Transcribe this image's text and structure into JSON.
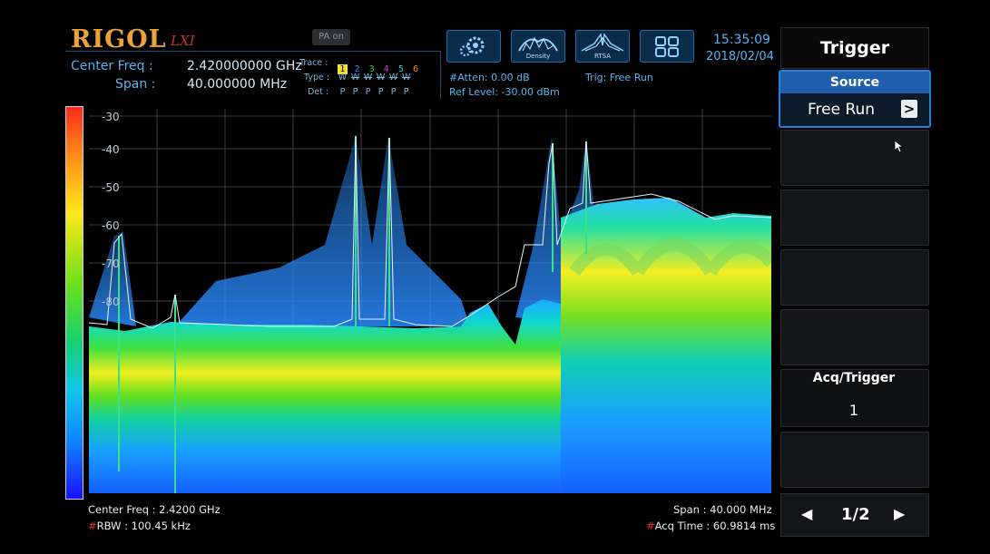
{
  "header": {
    "brand": "RIGOL",
    "brand_sub": "LXI",
    "pa_label": "PA on",
    "center_freq_label": "Center Freq :",
    "center_freq_value": "2.420000000 GHz",
    "span_label": "Span :",
    "span_value": "40.000000 MHz",
    "trace_label": "Trace :",
    "trace_numbers": [
      "1",
      "2",
      "3",
      "4",
      "5",
      "6"
    ],
    "trace_colors": [
      "#f5e32a",
      "#1e90ff",
      "#2ecc40",
      "#e040e0",
      "#21d4e0",
      "#ff8a1a"
    ],
    "type_label": "Type :",
    "type_values": [
      "W",
      "W",
      "W",
      "W",
      "W",
      "W"
    ],
    "det_label": "Det :",
    "det_values": [
      "P",
      "P",
      "P",
      "P",
      "P",
      "P"
    ],
    "atten": "#Atten: 0.00 dB",
    "ref_level": "Ref Level: -30.00 dBm",
    "trig": "Trig: Free Run",
    "buttons": [
      {
        "icon": "settings-gears-icon",
        "caption": ""
      },
      {
        "icon": "density-icon",
        "caption": "Density"
      },
      {
        "icon": "rtsa-icon",
        "caption": "RTSA"
      },
      {
        "icon": "layout-grid-icon",
        "caption": ""
      }
    ],
    "time": "15:35:09",
    "date": "2018/02/04"
  },
  "plot": {
    "y_ticks": [
      "-30",
      "-40",
      "-50",
      "-60",
      "-70",
      "-80"
    ],
    "colorbar": [
      "#ff2a1a",
      "#ff8a1a",
      "#ffe81a",
      "#6ee01a",
      "#18d070",
      "#10c8e8",
      "#1080ff",
      "#1a10ff"
    ]
  },
  "footer": {
    "center_freq": "Center Freq : 2.4200 GHz",
    "rbw": "RBW : 100.45 kHz",
    "span": "Span : 40.000 MHz",
    "acq_time": "Acq Time : 60.9814 ms"
  },
  "menu": {
    "title": "Trigger",
    "source_label": "Source",
    "source_value": "Free Run",
    "source_arrow": ">",
    "acq_label": "Acq/Trigger",
    "acq_value": "1",
    "page": "1/2",
    "prev": "◀",
    "next": "▶"
  }
}
